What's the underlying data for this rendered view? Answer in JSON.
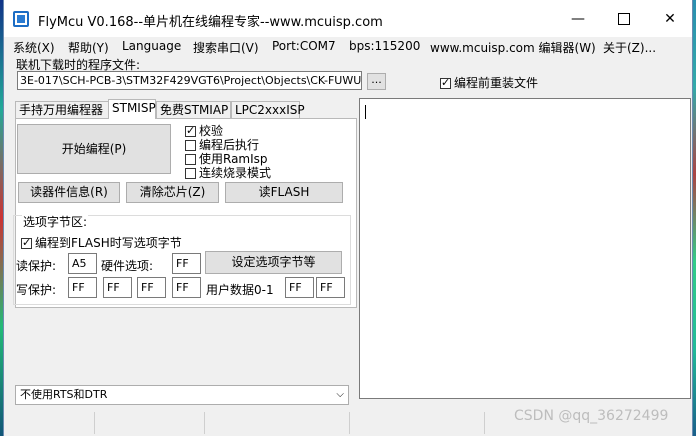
{
  "window": {
    "title": "FlyMcu V0.168--单片机在线编程专家--www.mcuisp.com",
    "minimize_glyph": "—",
    "close_glyph": "✕"
  },
  "menu": [
    "系统(X)",
    "帮助(Y)",
    "Language",
    "搜索串口(V)",
    "Port:COM7",
    "bps:115200",
    "www.mcuisp.com 编辑器(W)",
    "关于(Z)..."
  ],
  "file": {
    "label": "联机下载时的程序文件:",
    "path": "3E-017\\SCH-PCB-3\\STM32F429VGT6\\Project\\Objects\\CK-FUWUQI.hex",
    "browse_label": "...",
    "reload_label": "编程前重装文件",
    "reload_checked": true
  },
  "tabs": [
    "手持万用编程器",
    "STMISP",
    "免费STMIAP",
    "LPC2xxxISP"
  ],
  "active_tab": "STMISP",
  "stmisp": {
    "start_button": "开始编程(P)",
    "options": [
      {
        "label": "校验",
        "checked": true
      },
      {
        "label": "编程后执行",
        "checked": false
      },
      {
        "label": "使用RamIsp",
        "checked": false
      },
      {
        "label": "连续烧录模式",
        "checked": false
      }
    ],
    "read_info_button": "读器件信息(R)",
    "erase_button": "清除芯片(Z)",
    "read_flash_button": "读FLASH",
    "group_title": "选项字节区:",
    "write_option_label": "编程到FLASH时写选项字节",
    "write_option_checked": true,
    "read_protect_label": "读保护:",
    "read_protect_value": "A5",
    "hw_option_label": "硬件选项:",
    "hw_option_value": "FF",
    "set_option_button": "设定选项字节等",
    "write_protect_label": "写保护:",
    "write_protect_values": [
      "FF",
      "FF",
      "FF",
      "FF"
    ],
    "user_data_label": "用户数据0-1",
    "user_data_values": [
      "FF",
      "FF"
    ]
  },
  "rts_dtr_select": "不使用RTS和DTR",
  "watermark": "CSDN @qq_36272499"
}
